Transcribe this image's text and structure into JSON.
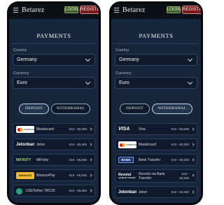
{
  "header": {
    "logo": "Betarez",
    "login_label": "LOGIN",
    "register_label": "REGISTER"
  },
  "payments_title": "PAYMENTS",
  "country": {
    "label": "Country",
    "value": "Germany"
  },
  "currency": {
    "label": "Currency",
    "value": "Euro"
  },
  "tabs": {
    "deposit": "DEPOSIT",
    "withdrawal": "WITHDRAWAL"
  },
  "deposit_methods": [
    {
      "logo": "mastercard",
      "logo_text": "mastercard",
      "name": "Mastercard",
      "limits": "€10 - €5,000"
    },
    {
      "logo": "jeton",
      "logo_text": "Jetonbank",
      "name": "Jeton",
      "limits": "€10 - €5,000"
    },
    {
      "logo": "mifinity",
      "logo_text": "MiFINITY",
      "name": "MiFinity",
      "limits": "€10 - €5,000"
    },
    {
      "logo": "binance",
      "logo_text": "BINANCE PAY",
      "name": "BinancePay",
      "limits": "€10 - €5,000"
    },
    {
      "logo": "usdt",
      "logo_text": "",
      "name": "USDTether TRC20",
      "limits": "€10 - €5,000"
    }
  ],
  "withdrawal_methods": [
    {
      "logo": "visa",
      "logo_text": "VISA",
      "name": "Visa",
      "limits": "€10 - €5,000"
    },
    {
      "logo": "mastercard",
      "logo_text": "mastercard",
      "name": "Mastercard",
      "limits": "€10 - €5,000"
    },
    {
      "logo": "bank",
      "logo_text": "BANK",
      "name": "Bank Transfer",
      "limits": "€10 - €5,000"
    },
    {
      "logo": "revolut",
      "logo_text": "Revolut",
      "logo_subtext": "via Bank Transfer",
      "name": "Revolut via Bank Transfer",
      "limits": "€10 - €5,000"
    },
    {
      "logo": "jeton",
      "logo_text": "Jetonbank",
      "name": "Jeton",
      "limits": "€10 - €5,000"
    }
  ],
  "colors": {
    "background": "#17263d",
    "register": "#7a1a1a",
    "login": "#3f5d2a",
    "panel": "#0f1b2d"
  }
}
